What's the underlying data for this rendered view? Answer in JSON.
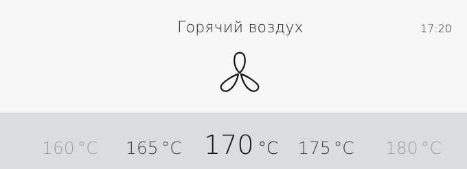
{
  "header": {
    "title": "Горячий воздух",
    "time": "17:20"
  },
  "mode": {
    "icon": "fan-icon"
  },
  "temperature": {
    "selected_value": "170",
    "options": [
      {
        "value": "160",
        "unit": "°C"
      },
      {
        "value": "165",
        "unit": "°C"
      },
      {
        "value": "170",
        "unit": "°C"
      },
      {
        "value": "175",
        "unit": "°C"
      },
      {
        "value": "180",
        "unit": "°C"
      }
    ]
  },
  "colors": {
    "top_background": "#f7f7f7",
    "selector_background": "#d9dde0",
    "faded_text": "#9aa0a5",
    "near_text": "#3a3f44",
    "selected_text": "#111111"
  }
}
